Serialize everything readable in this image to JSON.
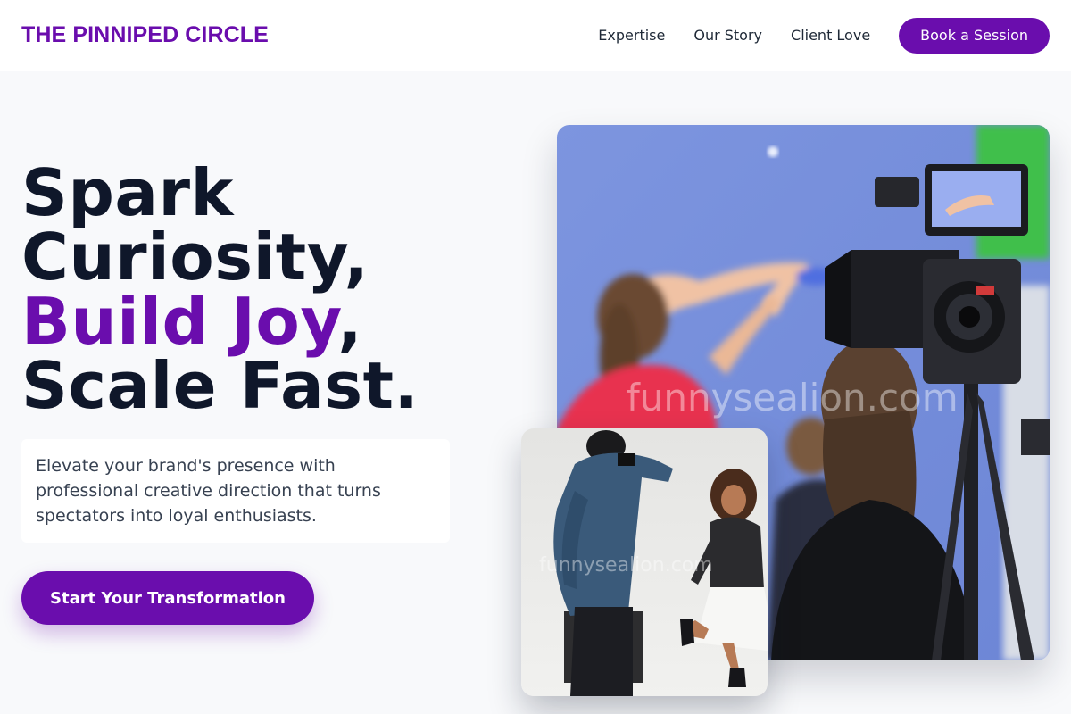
{
  "brand": {
    "name": "THE PINNIPED CIRCLE"
  },
  "nav": {
    "links": [
      {
        "label": "Expertise"
      },
      {
        "label": "Our Story"
      },
      {
        "label": "Client Love"
      }
    ],
    "cta_label": "Book a Session"
  },
  "hero": {
    "line1": "Spark",
    "line2": "Curiosity,",
    "line3_accent": "Build Joy",
    "line3_punct": ",",
    "line4": "Scale Fast.",
    "description": "Elevate your brand's presence with professional creative direction that turns spectators into loyal enthusiasts.",
    "cta_label": "Start Your Transformation"
  },
  "images": {
    "main_watermark": "funnysealion.com",
    "small_watermark": "funnysealion.com"
  },
  "colors": {
    "brand": "#6a0dad",
    "heading": "#0f172a",
    "background": "#f8f9fb"
  }
}
